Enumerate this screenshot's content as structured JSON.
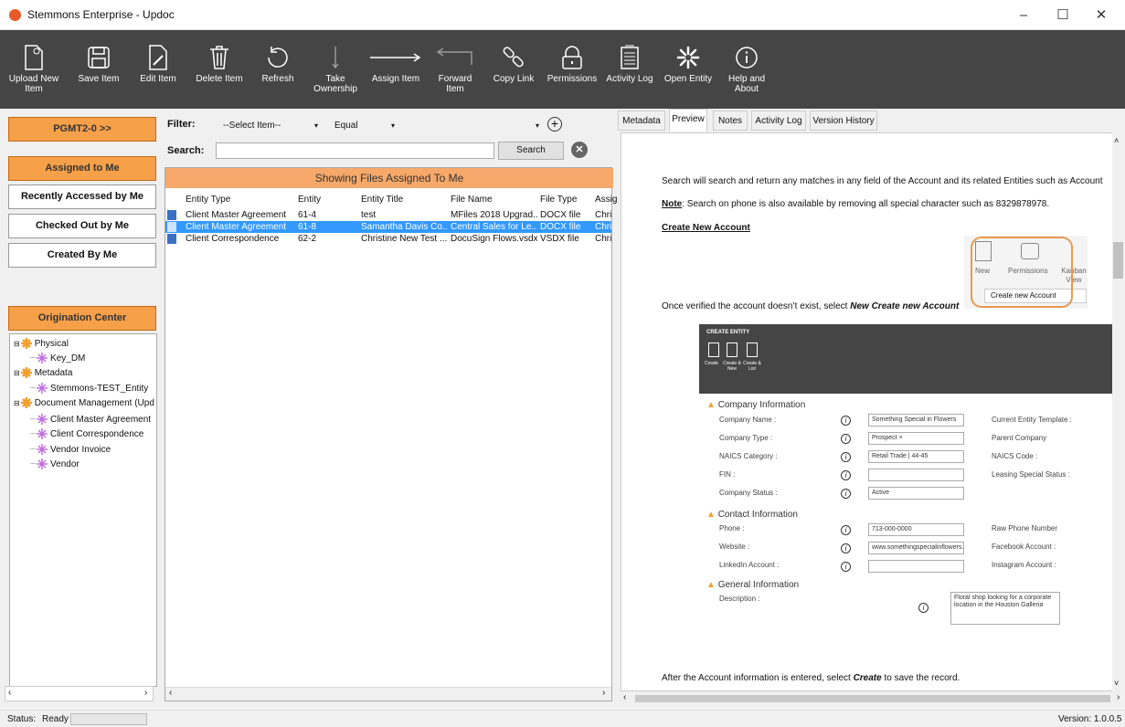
{
  "window": {
    "title": "Stemmons Enterprise - Updoc",
    "minimize": "–",
    "maximize": "☐",
    "close": "✕"
  },
  "ribbon": {
    "buttons": [
      {
        "label": "Upload New Item",
        "icon": "upload-icon"
      },
      {
        "label": "Save Item",
        "icon": "save-icon"
      },
      {
        "label": "Edit Item",
        "icon": "edit-icon"
      },
      {
        "label": "Delete Item",
        "icon": "trash-icon"
      },
      {
        "label": "Refresh",
        "icon": "refresh-icon"
      },
      {
        "label": "Take Ownership",
        "icon": "take-ownership-icon"
      },
      {
        "label": "Assign Item",
        "icon": "arrow-right-icon"
      },
      {
        "label": "Forward Item",
        "icon": "forward-icon"
      },
      {
        "label": "Copy Link",
        "icon": "link-icon"
      },
      {
        "label": "Permissions",
        "icon": "lock-icon"
      },
      {
        "label": "Activity Log",
        "icon": "clipboard-icon"
      },
      {
        "label": "Open Entity",
        "icon": "entity-icon"
      },
      {
        "label": "Help and About",
        "icon": "info-icon"
      }
    ]
  },
  "left": {
    "pgmt": "PGMT2-0 >>",
    "assigned": "Assigned to Me",
    "recent": "Recently Accessed by Me",
    "checked": "Checked Out by Me",
    "created": "Created By Me",
    "origination": "Origination Center",
    "tree": [
      {
        "label": "Physical",
        "level": 0
      },
      {
        "label": "Key_DM",
        "level": 1
      },
      {
        "label": "Metadata",
        "level": 0
      },
      {
        "label": "Stemmons-TEST_Entity",
        "level": 1
      },
      {
        "label": "Document Management (Upd",
        "level": 0
      },
      {
        "label": "Client Master Agreement",
        "level": 1
      },
      {
        "label": "Client Correspondence",
        "level": 1
      },
      {
        "label": "Vendor Invoice",
        "level": 1
      },
      {
        "label": "Vendor",
        "level": 1
      }
    ]
  },
  "filter": {
    "label": "Filter:",
    "select_item": "--Select Item--",
    "operator": "Equal",
    "value": "",
    "search_label": "Search:",
    "search_value": "",
    "search_button": "Search"
  },
  "grid": {
    "header": "Showing Files Assigned To Me",
    "columns": [
      "Entity Type",
      "Entity",
      "Entity Title",
      "File Name",
      "File Type",
      "Assig"
    ],
    "rows": [
      {
        "type": "Client Master Agreement",
        "entity": "61-4",
        "title": "test",
        "file": "MFiles 2018 Upgrad...",
        "ftype": "DOCX file",
        "assign": "Chris",
        "selected": false
      },
      {
        "type": "Client Master Agreement",
        "entity": "61-8",
        "title": "Samantha Davis Co...",
        "file": "Central Sales for Le...",
        "ftype": "DOCX file",
        "assign": "Chris",
        "selected": true
      },
      {
        "type": "Client Correspondence",
        "entity": "62-2",
        "title": "Christine New Test ...",
        "file": "DocuSign Flows.vsdx",
        "ftype": "VSDX file",
        "assign": "Chris",
        "selected": false
      }
    ]
  },
  "tabs": [
    "Metadata",
    "Preview",
    "Notes",
    "Activity Log",
    "Version History"
  ],
  "preview": {
    "p1": "Search will search and return any matches in any field of the Account and its related Entities such as Account",
    "note_label": "Note",
    "note_text": ": Search on phone is also available by removing all special character such as 8329878978.",
    "create_link": "Create New Account",
    "mini_new": "New",
    "mini_perm": "Permissions",
    "mini_kanban": "Kanban View",
    "mini_menu": "Create new Account",
    "p2_a": "Once verified the account doesn’t exist, select ",
    "p2_b": "New  Create new Account",
    "form": {
      "title": "CREATE ENTITY",
      "btn1": "Create",
      "btn2": "Create & New",
      "btn3": "Create & List",
      "sec1": "Company Information",
      "company_name": "Company Name :",
      "company_name_val": "Something Special in Flowers",
      "company_type": "Company Type :",
      "company_type_val": "Prospect ×",
      "naics": "NAICS Category :",
      "naics_val": "Retail Trade | 44-45",
      "fin": "FIN :",
      "status": "Company Status :",
      "status_val": "Active",
      "r_template": "Current Entity Template :",
      "r_parent": "Parent Company",
      "r_naics": "NAICS Code :",
      "r_leasing": "Leasing Special Status :",
      "sec2": "Contact Information",
      "phone": "Phone :",
      "phone_val": "713-000-0000",
      "website": "Website :",
      "website_val": "www.somethingspecialinflowers.c",
      "linkedin": "LinkedIn Account :",
      "r_raw": "Raw Phone Number",
      "r_fb": "Facebook Account :",
      "r_ig": "Instagram Account :",
      "sec3": "General Information",
      "desc": "Description :",
      "desc_val": "Floral shop looking for a corporate location in the Houston Galleria"
    },
    "p3_a": "After the Account information is entered, select ",
    "p3_b": "Create",
    "p3_c": " to save the record."
  },
  "status": {
    "label": "Status:",
    "value": "Ready",
    "version": "Version: 1.0.0.5"
  },
  "colors": {
    "ribbon": "#454545",
    "orange": "#f6a04a",
    "selected": "#3399ff"
  }
}
